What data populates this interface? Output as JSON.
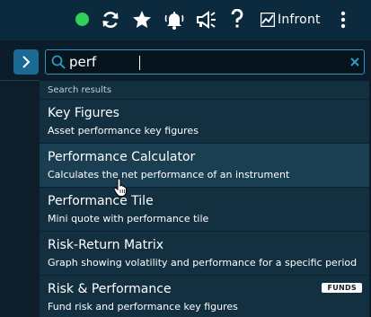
{
  "topbar": {
    "status": "online",
    "icons": [
      "status-dot",
      "refresh-icon",
      "star-icon",
      "bell-icon",
      "megaphone-icon",
      "help-icon"
    ],
    "logo_text": "Infront",
    "menu_icon": "kebab-menu-icon"
  },
  "sidebar": {
    "toggle_icon": "chevron-right-icon"
  },
  "search": {
    "value": "perf",
    "placeholder": "",
    "icon": "search-icon",
    "clear_icon": "close-icon"
  },
  "dropdown": {
    "header": "Search results",
    "results": [
      {
        "title": "Key Figures",
        "description": "Asset performance key figures",
        "badge": ""
      },
      {
        "title": "Performance Calculator",
        "description": "Calculates the net performance of an instrument",
        "badge": ""
      },
      {
        "title": "Performance Tile",
        "description": "Mini quote with performance tile",
        "badge": ""
      },
      {
        "title": "Risk-Return Matrix",
        "description": "Graph showing volatility and performance for a specific period",
        "badge": ""
      },
      {
        "title": "Risk & Performance",
        "description": "Fund risk and performance key figures",
        "badge": "FUNDS"
      }
    ],
    "hovered_index": 1
  },
  "colors": {
    "topbar_bg": "#0b2a3d",
    "dropdown_bg": "#12303f",
    "hover_bg": "#1a3e52",
    "accent": "#2b97c4",
    "status_green": "#2fd158"
  }
}
